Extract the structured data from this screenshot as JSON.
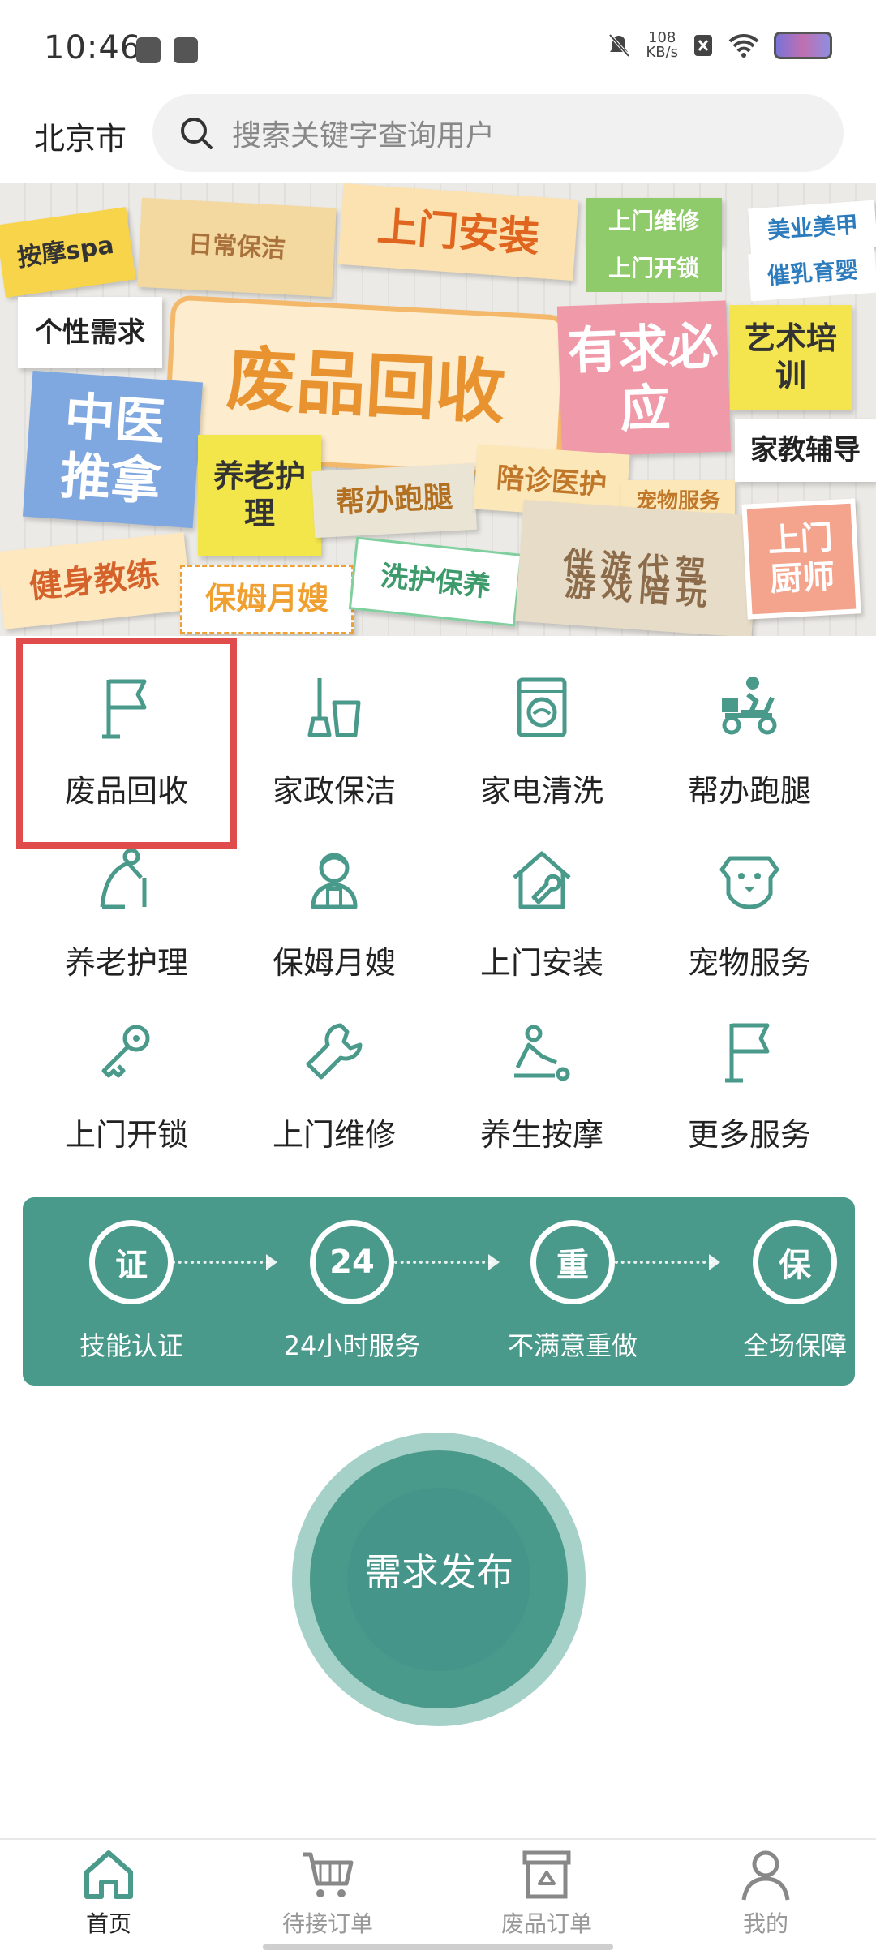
{
  "status": {
    "time": "10:46",
    "speed_value": "108",
    "speed_unit": "KB/s"
  },
  "header": {
    "city": "北京市",
    "search_placeholder": "搜索关键字查询用户"
  },
  "banner": {
    "notes": [
      "按摩spa",
      "日常保洁",
      "上门安装",
      "上门维修",
      "上门开锁",
      "美业美甲",
      "催乳育婴",
      "个性需求",
      "废品回收",
      "有求必应",
      "艺术培训",
      "中医推拿",
      "养老护理",
      "帮办跑腿",
      "陪诊医护",
      "宠物服务",
      "家教辅导",
      "健身教练",
      "保姆月嫂",
      "洗护保养",
      "伴游代驾",
      "游戏陪玩",
      "上门厨师"
    ]
  },
  "services": [
    {
      "label": "废品回收",
      "icon": "flag-icon"
    },
    {
      "label": "家政保洁",
      "icon": "broom-bucket-icon"
    },
    {
      "label": "家电清洗",
      "icon": "washing-machine-icon"
    },
    {
      "label": "帮办跑腿",
      "icon": "delivery-scooter-icon"
    },
    {
      "label": "养老护理",
      "icon": "elder-cane-icon"
    },
    {
      "label": "保姆月嫂",
      "icon": "nanny-icon"
    },
    {
      "label": "上门安装",
      "icon": "house-wrench-icon"
    },
    {
      "label": "宠物服务",
      "icon": "dog-icon"
    },
    {
      "label": "上门开锁",
      "icon": "key-icon"
    },
    {
      "label": "上门维修",
      "icon": "wrench-icon"
    },
    {
      "label": "养生按摩",
      "icon": "massage-icon"
    },
    {
      "label": "更多服务",
      "icon": "flag-icon"
    }
  ],
  "guarantees": [
    {
      "badge": "证",
      "label": "技能认证"
    },
    {
      "badge": "24",
      "label": "24小时服务"
    },
    {
      "badge": "重",
      "label": "不满意重做"
    },
    {
      "badge": "保",
      "label": "全场保障"
    }
  ],
  "publish": {
    "label": "需求发布"
  },
  "nav": [
    {
      "label": "首页",
      "icon": "home-icon",
      "active": true
    },
    {
      "label": "待接订单",
      "icon": "cart-icon",
      "active": false
    },
    {
      "label": "废品订单",
      "icon": "recycle-bin-icon",
      "active": false
    },
    {
      "label": "我的",
      "icon": "user-icon",
      "active": false
    }
  ],
  "colors": {
    "accent": "#4a9a8b",
    "highlight": "#e04b4b"
  }
}
